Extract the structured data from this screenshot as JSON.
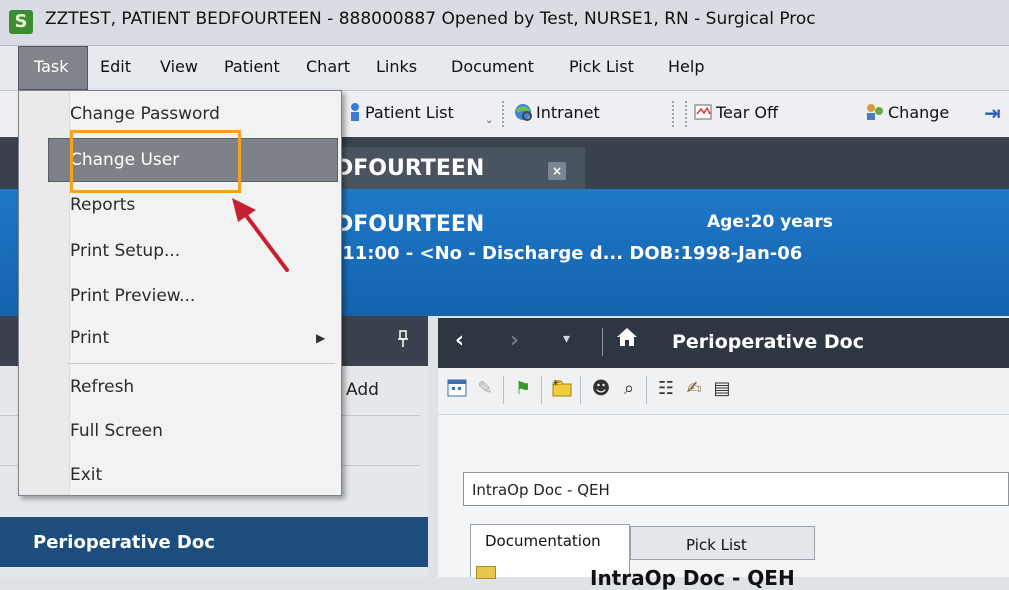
{
  "window": {
    "logo": "S",
    "title": "ZZTEST, PATIENT BEDFOURTEEN - 888000887 Opened by Test, NURSE1, RN - Surgical Proc"
  },
  "menubar": [
    "Task",
    "Edit",
    "View",
    "Patient",
    "Chart",
    "Links",
    "Document",
    "Pick List",
    "Help"
  ],
  "toolbar": {
    "patient_list": "Patient List",
    "intranet": "Intranet",
    "tear_off": "Tear Off",
    "change": "Change"
  },
  "patient_tab": {
    "name": "DFOURTEEN",
    "close": "×"
  },
  "banner": {
    "name": "DFOURTEEN",
    "age": "Age:20 years",
    "line2": ":11:00 - <No - Discharge d... DOB:1998-Jan-06"
  },
  "left_pane": {
    "pin": "ꟷ",
    "add_label": "Add",
    "perioperative": "Perioperative Doc"
  },
  "nav": {
    "title": "Perioperative Doc"
  },
  "doc": {
    "select_value": "IntraOp Doc - QEH",
    "tabs": [
      "Documentation",
      "Pick List"
    ],
    "under_text": "IntraOp Doc - QEH"
  },
  "task_menu": {
    "items": [
      "Change Password",
      "Change User",
      "Reports",
      "Print Setup...",
      "Print Preview...",
      "Print",
      "Refresh",
      "Full Screen",
      "Exit"
    ],
    "highlighted": "Change User"
  },
  "colors": {
    "highlight_box": "#f5a21a",
    "arrow": "#c8202e",
    "banner_blue": "#1f78c8"
  }
}
